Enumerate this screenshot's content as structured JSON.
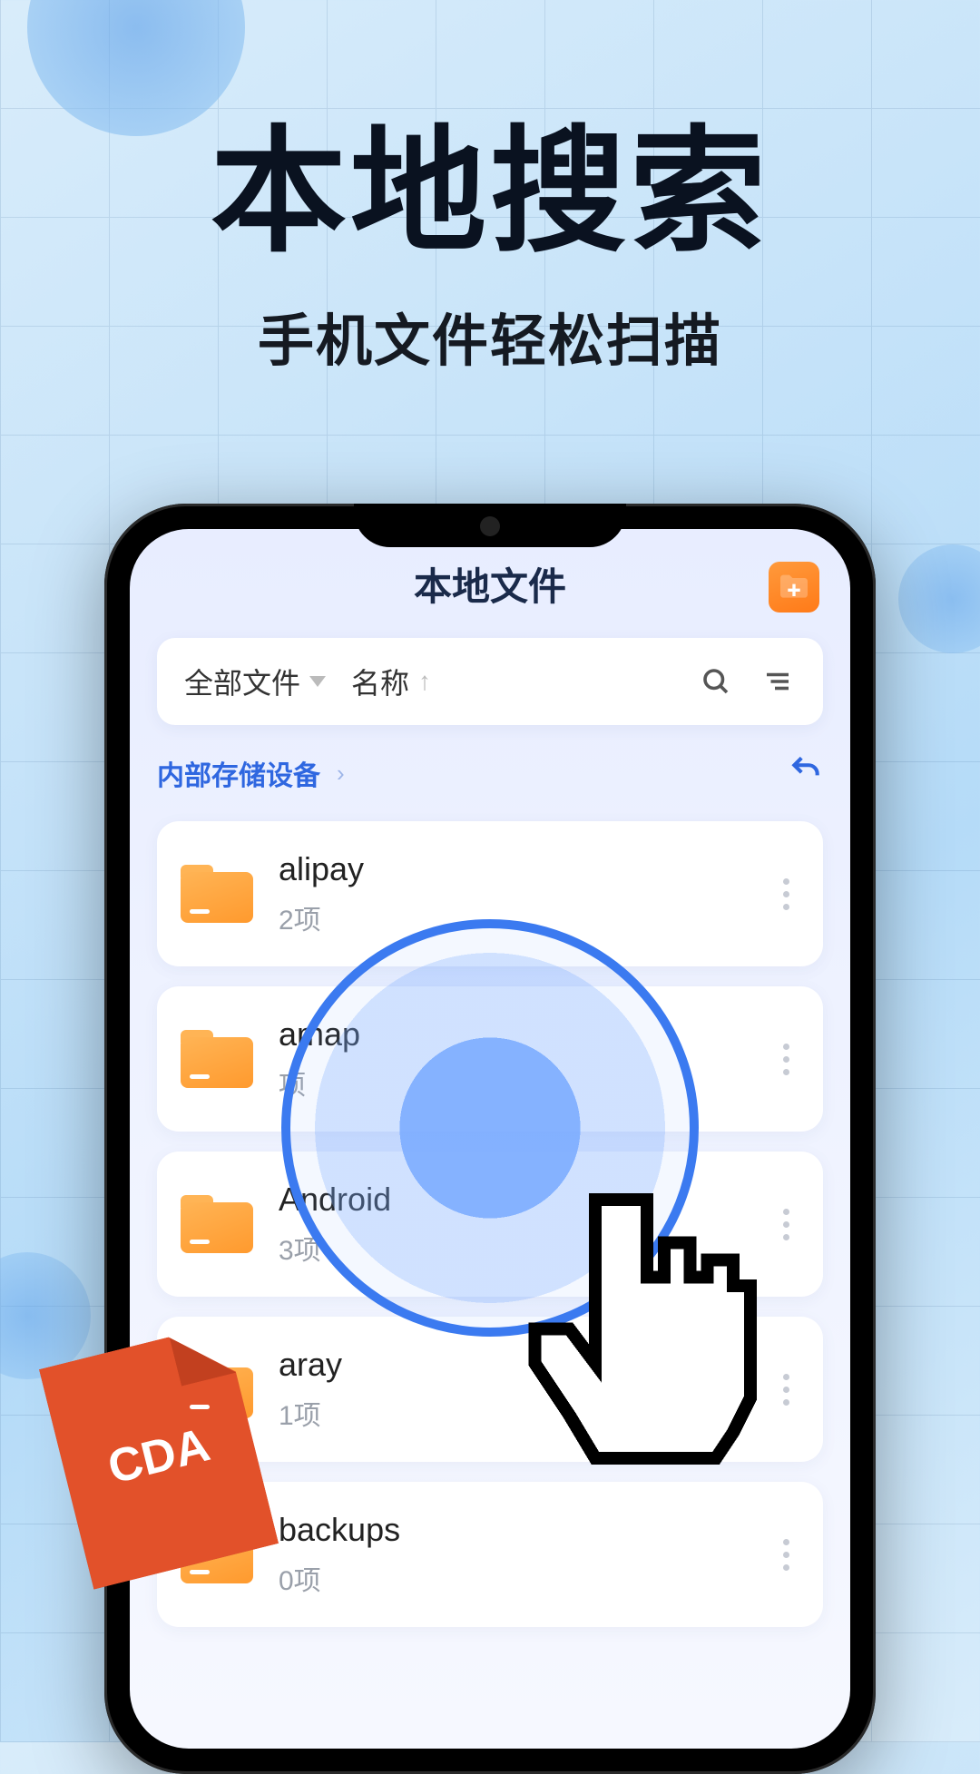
{
  "hero": {
    "title": "本地搜索",
    "subtitle": "手机文件轻松扫描"
  },
  "app": {
    "title": "本地文件",
    "filter": {
      "scope": "全部文件",
      "sort": "名称"
    },
    "breadcrumb": {
      "root": "内部存储设备"
    }
  },
  "files": [
    {
      "name": "alipay",
      "count": "2项"
    },
    {
      "name": "amap",
      "count": "项"
    },
    {
      "name": "Android",
      "count": "3项"
    },
    {
      "name": "aray",
      "count": "1项"
    },
    {
      "name": "backups",
      "count": "0项"
    }
  ],
  "sticker": {
    "label": "CDA"
  }
}
